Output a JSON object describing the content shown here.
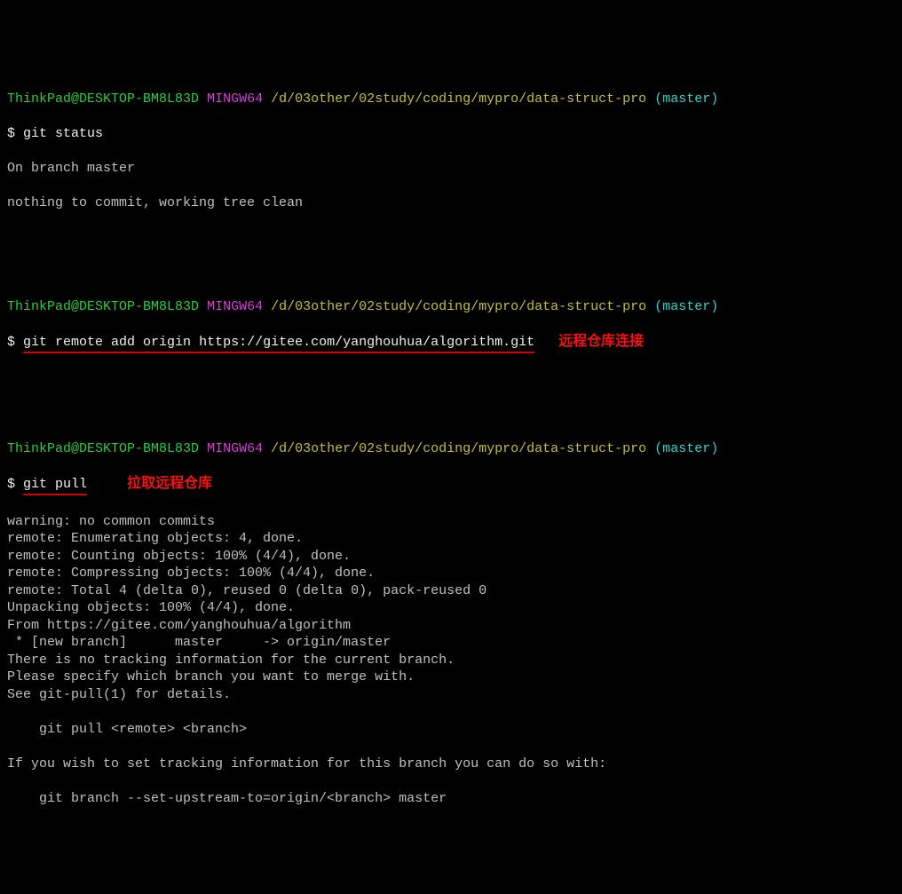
{
  "prompt": {
    "user": "ThinkPad@DESKTOP-BM8L83D",
    "sys": "MINGW64",
    "path": "/d/03other/02study/coding/mypro/data-struct-pro",
    "branch": "(master)",
    "dollar": "$"
  },
  "block1": {
    "cmd": "git status",
    "out1": "On branch master",
    "out2": "nothing to commit, working tree clean"
  },
  "block2": {
    "cmd": "git remote add origin https://gitee.com/yanghouhua/algorithm.git",
    "annot": "远程仓库连接"
  },
  "block3": {
    "cmd": "git pull",
    "annot": "拉取远程仓库",
    "out": [
      "warning: no common commits",
      "remote: Enumerating objects: 4, done.",
      "remote: Counting objects: 100% (4/4), done.",
      "remote: Compressing objects: 100% (4/4), done.",
      "remote: Total 4 (delta 0), reused 0 (delta 0), pack-reused 0",
      "Unpacking objects: 100% (4/4), done.",
      "From https://gitee.com/yanghouhua/algorithm",
      " * [new branch]      master     -> origin/master",
      "There is no tracking information for the current branch.",
      "Please specify which branch you want to merge with.",
      "See git-pull(1) for details.",
      "",
      "    git pull <remote> <branch>",
      "",
      "If you wish to set tracking information for this branch you can do so with:",
      "",
      "    git branch --set-upstream-to=origin/<branch> master"
    ]
  }
}
